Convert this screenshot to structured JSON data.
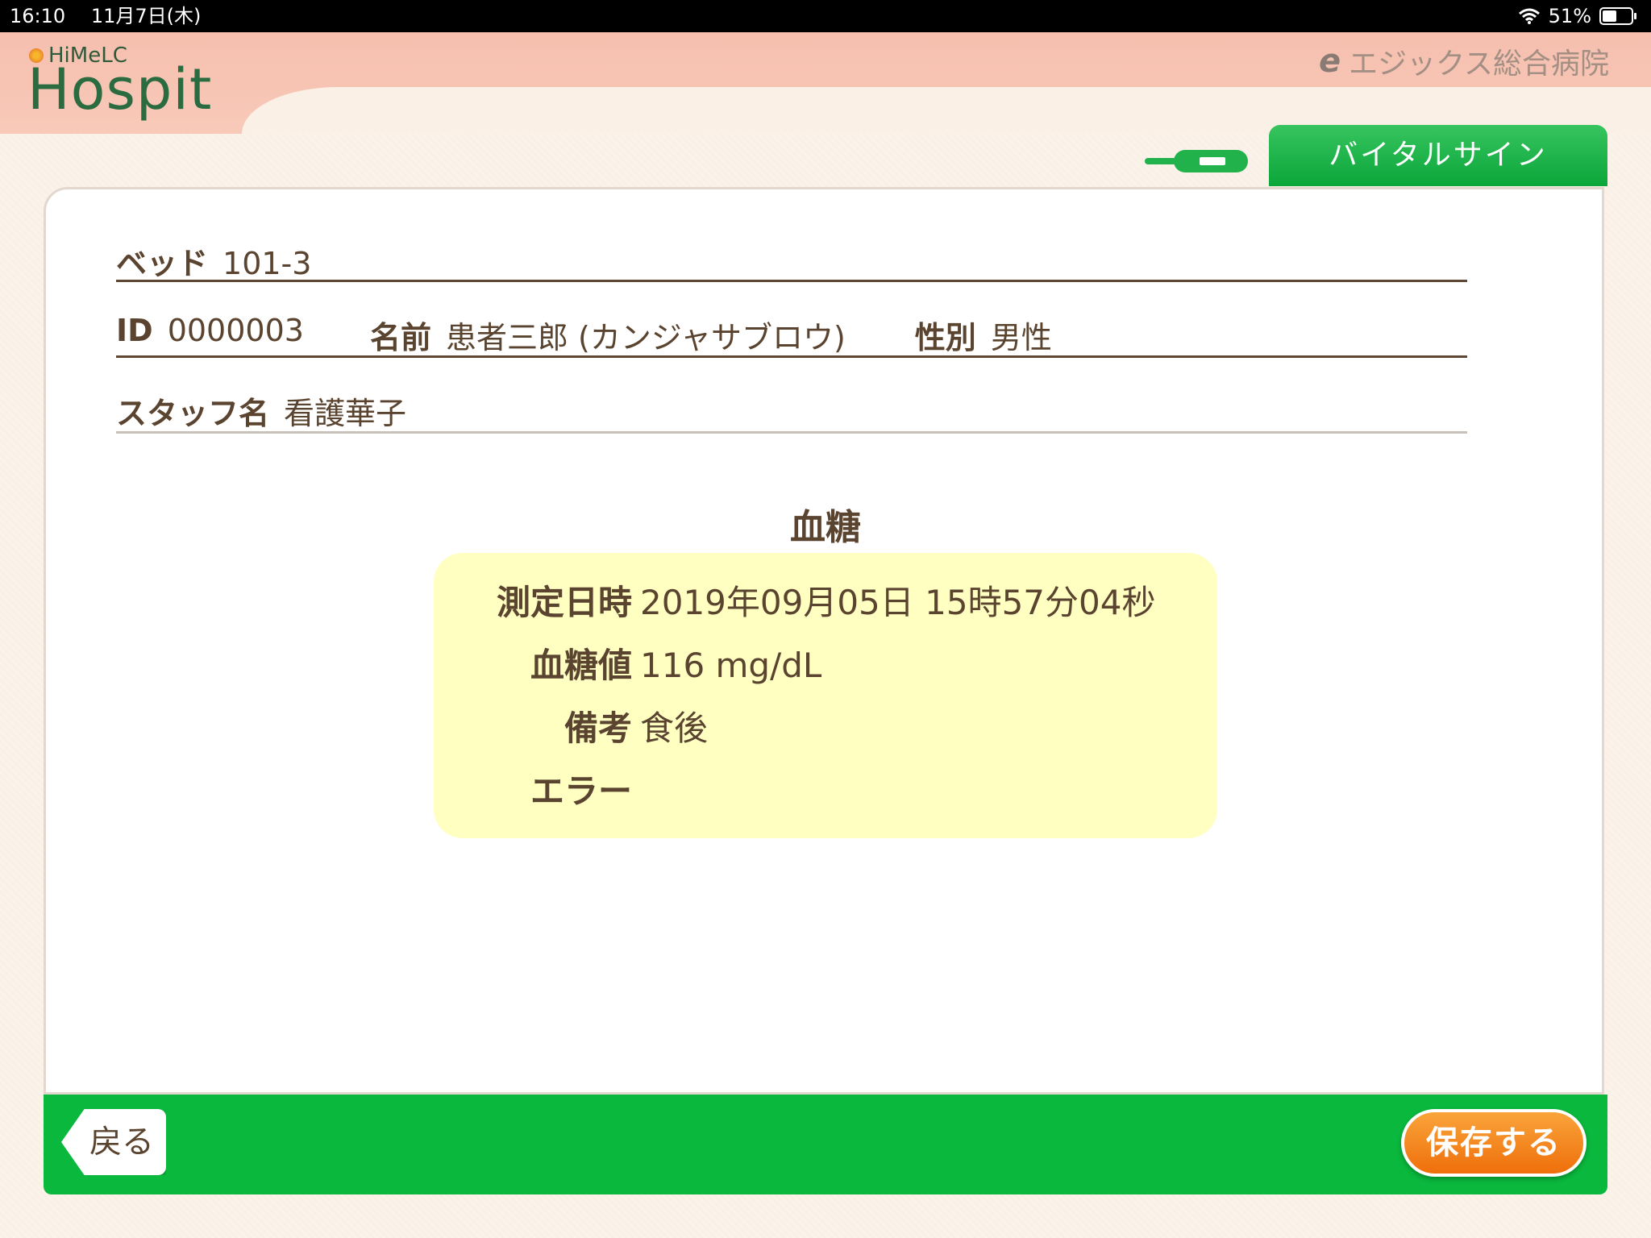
{
  "status_bar": {
    "time": "16:10",
    "date": "11月7日(木)",
    "battery_pct": "51%",
    "battery_level": 0.51
  },
  "header": {
    "logo_small": "HiMeLC",
    "logo_main": "Hospit",
    "hospital_mark": "e",
    "hospital_name": "エジックス総合病院"
  },
  "tab": {
    "label": "バイタルサイン"
  },
  "patient": {
    "bed_label": "ベッド",
    "bed_value": "101-3",
    "id_label": "ID",
    "id_value": "0000003",
    "name_label": "名前",
    "name_value": "患者三郎 (カンジャサブロウ)",
    "sex_label": "性別",
    "sex_value": "男性",
    "staff_label": "スタッフ名",
    "staff_value": "看護華子"
  },
  "measurement": {
    "title": "血糖",
    "rows": [
      {
        "label": "測定日時",
        "value": "2019年09月05日 15時57分04秒"
      },
      {
        "label": "血糖値",
        "value": "116 mg/dL"
      },
      {
        "label": "備考",
        "value": "食後"
      },
      {
        "label": "エラー",
        "value": ""
      }
    ]
  },
  "buttons": {
    "back": "戻る",
    "save": "保存する"
  }
}
